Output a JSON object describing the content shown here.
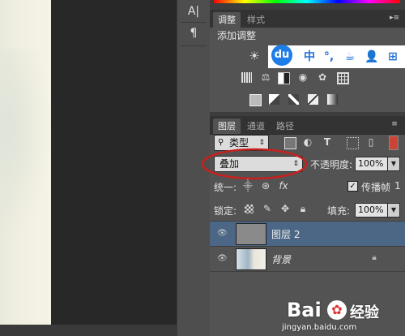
{
  "toolbar": {
    "tool1": "A|",
    "tool2": "¶"
  },
  "adjustments_panel": {
    "tabs": [
      {
        "label": "调整"
      },
      {
        "label": "样式"
      }
    ],
    "heading": "添加调整"
  },
  "ime_bar": {
    "logo": "du",
    "items": [
      "中",
      "°,",
      "☕",
      "👤",
      "⊞"
    ]
  },
  "layers_panel": {
    "tabs": [
      {
        "label": "图层"
      },
      {
        "label": "通道"
      },
      {
        "label": "路径"
      }
    ],
    "filter": {
      "icon": "search-icon",
      "label": "类型"
    },
    "blend_mode": "叠加",
    "opacity_label": "不透明度:",
    "opacity_value": "100%",
    "unify_label": "统一:",
    "propagate_label": "传播帧",
    "propagate_value": "1",
    "lock_label": "锁定:",
    "fill_label": "填充:",
    "fill_value": "100%",
    "layers": [
      {
        "name": "图层 2",
        "selected": true
      },
      {
        "name": "背景",
        "locked": true
      }
    ]
  },
  "colors": {
    "accent_ime": "#1e7de6",
    "annotation": "#c8201e",
    "selected_row": "#4b6785"
  },
  "watermark": {
    "brand": "Bai",
    "suffix": "经验",
    "url": "jingyan.baidu.com"
  }
}
